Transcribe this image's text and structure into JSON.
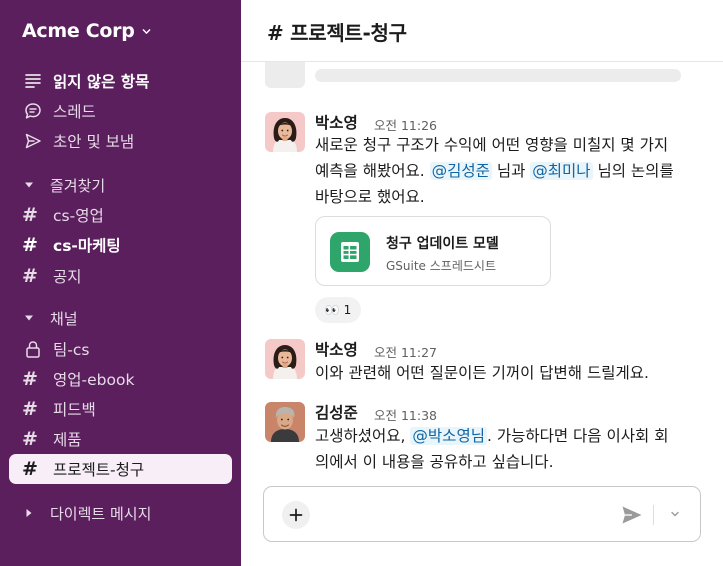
{
  "workspace": {
    "name": "Acme Corp"
  },
  "sidebar": {
    "top_items": [
      {
        "label": "읽지 않은 항목",
        "icon": "unread-icon"
      },
      {
        "label": "스레드",
        "icon": "threads-icon"
      },
      {
        "label": "초안 및 보냄",
        "icon": "send-icon"
      }
    ],
    "favorites_label": "즐겨찾기",
    "favorites": [
      {
        "label": "cs-영업"
      },
      {
        "label": "cs-마케팅"
      },
      {
        "label": "공지"
      }
    ],
    "channels_label": "채널",
    "channels": [
      {
        "label": "팀-cs"
      },
      {
        "label": "영업-ebook"
      },
      {
        "label": "피드백"
      },
      {
        "label": "제품"
      },
      {
        "label": "프로젝트-청구"
      }
    ],
    "dm_label": "다이렉트 메시지"
  },
  "channel": {
    "title": "# 프로젝트-청구"
  },
  "messages": [
    {
      "author": "박소영",
      "time": "오전 11:26",
      "line1": "새로운 청구 구조가 수익에 어떤 영향을 미칠지 몇 가지",
      "line2_pre": "예측을 해봤어요. ",
      "mention1": "@김성준",
      "line2_mid": " 님과 ",
      "mention2": "@최미나",
      "line2_post": " 님의 논의를",
      "line3": "바탕으로 했어요.",
      "attachment": {
        "title": "청구 업데이트 모델",
        "subtitle": "GSuite 스프레드시트"
      },
      "reaction": {
        "emoji": "👀",
        "count": "1"
      }
    },
    {
      "author": "박소영",
      "time": "오전 11:27",
      "text": "이와 관련해 어떤 질문이든 기꺼이 답변해 드릴게요."
    },
    {
      "author": "김성준",
      "time": "오전 11:38",
      "line1_pre": "고생하셨어요, ",
      "mention": "@박소영님",
      "line1_post": ". 가능하다면 다음 이사회 회",
      "line2": "의에서 이 내용을 공유하고 싶습니다."
    }
  ],
  "colors": {
    "sidebar": "#5a1f5c",
    "mention_bg": "#e8f5fa",
    "mention_text": "#1264a3",
    "sheet_icon": "#2ea56a"
  }
}
